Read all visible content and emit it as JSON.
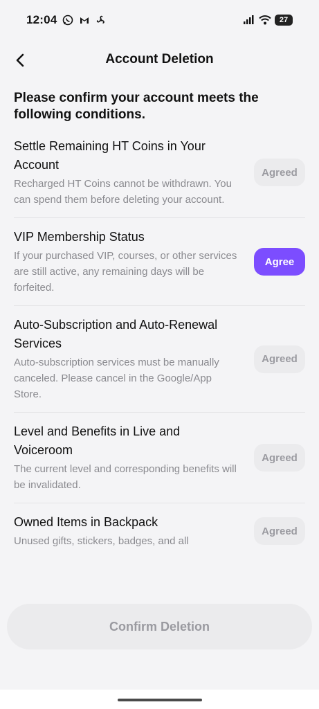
{
  "status_bar": {
    "time": "12:04",
    "battery": "27",
    "left_icons": [
      "whatsapp-icon",
      "gmail-icon",
      "fan-icon"
    ],
    "right_icons": [
      "signal-icon",
      "wifi-icon",
      "battery-icon"
    ]
  },
  "header": {
    "title": "Account Deletion",
    "back_icon": "chevron-left-icon"
  },
  "intro": "Please confirm your account meets the following conditions.",
  "conditions": [
    {
      "title": "Settle Remaining HT Coins in Your Account",
      "description": "Recharged HT Coins cannot be withdrawn. You can spend them before deleting your account.",
      "button": "Agreed",
      "state": "agreed"
    },
    {
      "title": "VIP Membership Status",
      "description": "If your purchased VIP, courses, or other services are still active, any remaining days will be forfeited.",
      "button": "Agree",
      "state": "pending"
    },
    {
      "title": "Auto-Subscription and Auto-Renewal Services",
      "description": "Auto-subscription services must be manually canceled. Please cancel in the Google/App Store.",
      "button": "Agreed",
      "state": "agreed"
    },
    {
      "title": "Level and Benefits in Live and Voiceroom",
      "description": "The current level and corresponding benefits will be invalidated.",
      "button": "Agreed",
      "state": "agreed"
    },
    {
      "title": "Owned Items in Backpack",
      "description": "Unused gifts, stickers, badges, and all",
      "button": "Agreed",
      "state": "agreed"
    }
  ],
  "footer": {
    "confirm_label": "Confirm Deletion"
  },
  "colors": {
    "accent": "#7c4dff",
    "background": "#f4f4f6",
    "disabled_bg": "#ebebed",
    "disabled_text": "#9a9aa0"
  }
}
